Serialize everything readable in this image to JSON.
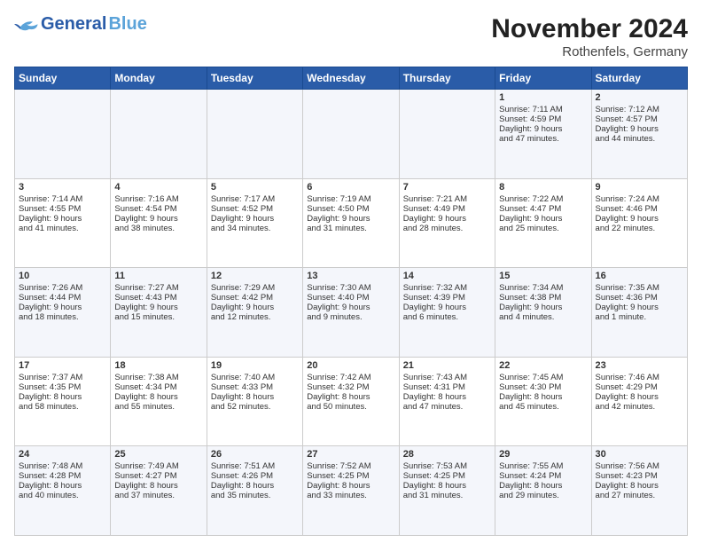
{
  "header": {
    "logo_general": "General",
    "logo_blue": "Blue",
    "title": "November 2024",
    "subtitle": "Rothenfels, Germany"
  },
  "weekdays": [
    "Sunday",
    "Monday",
    "Tuesday",
    "Wednesday",
    "Thursday",
    "Friday",
    "Saturday"
  ],
  "weeks": [
    [
      {
        "day": "",
        "lines": []
      },
      {
        "day": "",
        "lines": []
      },
      {
        "day": "",
        "lines": []
      },
      {
        "day": "",
        "lines": []
      },
      {
        "day": "",
        "lines": []
      },
      {
        "day": "1",
        "lines": [
          "Sunrise: 7:11 AM",
          "Sunset: 4:59 PM",
          "Daylight: 9 hours",
          "and 47 minutes."
        ]
      },
      {
        "day": "2",
        "lines": [
          "Sunrise: 7:12 AM",
          "Sunset: 4:57 PM",
          "Daylight: 9 hours",
          "and 44 minutes."
        ]
      }
    ],
    [
      {
        "day": "3",
        "lines": [
          "Sunrise: 7:14 AM",
          "Sunset: 4:55 PM",
          "Daylight: 9 hours",
          "and 41 minutes."
        ]
      },
      {
        "day": "4",
        "lines": [
          "Sunrise: 7:16 AM",
          "Sunset: 4:54 PM",
          "Daylight: 9 hours",
          "and 38 minutes."
        ]
      },
      {
        "day": "5",
        "lines": [
          "Sunrise: 7:17 AM",
          "Sunset: 4:52 PM",
          "Daylight: 9 hours",
          "and 34 minutes."
        ]
      },
      {
        "day": "6",
        "lines": [
          "Sunrise: 7:19 AM",
          "Sunset: 4:50 PM",
          "Daylight: 9 hours",
          "and 31 minutes."
        ]
      },
      {
        "day": "7",
        "lines": [
          "Sunrise: 7:21 AM",
          "Sunset: 4:49 PM",
          "Daylight: 9 hours",
          "and 28 minutes."
        ]
      },
      {
        "day": "8",
        "lines": [
          "Sunrise: 7:22 AM",
          "Sunset: 4:47 PM",
          "Daylight: 9 hours",
          "and 25 minutes."
        ]
      },
      {
        "day": "9",
        "lines": [
          "Sunrise: 7:24 AM",
          "Sunset: 4:46 PM",
          "Daylight: 9 hours",
          "and 22 minutes."
        ]
      }
    ],
    [
      {
        "day": "10",
        "lines": [
          "Sunrise: 7:26 AM",
          "Sunset: 4:44 PM",
          "Daylight: 9 hours",
          "and 18 minutes."
        ]
      },
      {
        "day": "11",
        "lines": [
          "Sunrise: 7:27 AM",
          "Sunset: 4:43 PM",
          "Daylight: 9 hours",
          "and 15 minutes."
        ]
      },
      {
        "day": "12",
        "lines": [
          "Sunrise: 7:29 AM",
          "Sunset: 4:42 PM",
          "Daylight: 9 hours",
          "and 12 minutes."
        ]
      },
      {
        "day": "13",
        "lines": [
          "Sunrise: 7:30 AM",
          "Sunset: 4:40 PM",
          "Daylight: 9 hours",
          "and 9 minutes."
        ]
      },
      {
        "day": "14",
        "lines": [
          "Sunrise: 7:32 AM",
          "Sunset: 4:39 PM",
          "Daylight: 9 hours",
          "and 6 minutes."
        ]
      },
      {
        "day": "15",
        "lines": [
          "Sunrise: 7:34 AM",
          "Sunset: 4:38 PM",
          "Daylight: 9 hours",
          "and 4 minutes."
        ]
      },
      {
        "day": "16",
        "lines": [
          "Sunrise: 7:35 AM",
          "Sunset: 4:36 PM",
          "Daylight: 9 hours",
          "and 1 minute."
        ]
      }
    ],
    [
      {
        "day": "17",
        "lines": [
          "Sunrise: 7:37 AM",
          "Sunset: 4:35 PM",
          "Daylight: 8 hours",
          "and 58 minutes."
        ]
      },
      {
        "day": "18",
        "lines": [
          "Sunrise: 7:38 AM",
          "Sunset: 4:34 PM",
          "Daylight: 8 hours",
          "and 55 minutes."
        ]
      },
      {
        "day": "19",
        "lines": [
          "Sunrise: 7:40 AM",
          "Sunset: 4:33 PM",
          "Daylight: 8 hours",
          "and 52 minutes."
        ]
      },
      {
        "day": "20",
        "lines": [
          "Sunrise: 7:42 AM",
          "Sunset: 4:32 PM",
          "Daylight: 8 hours",
          "and 50 minutes."
        ]
      },
      {
        "day": "21",
        "lines": [
          "Sunrise: 7:43 AM",
          "Sunset: 4:31 PM",
          "Daylight: 8 hours",
          "and 47 minutes."
        ]
      },
      {
        "day": "22",
        "lines": [
          "Sunrise: 7:45 AM",
          "Sunset: 4:30 PM",
          "Daylight: 8 hours",
          "and 45 minutes."
        ]
      },
      {
        "day": "23",
        "lines": [
          "Sunrise: 7:46 AM",
          "Sunset: 4:29 PM",
          "Daylight: 8 hours",
          "and 42 minutes."
        ]
      }
    ],
    [
      {
        "day": "24",
        "lines": [
          "Sunrise: 7:48 AM",
          "Sunset: 4:28 PM",
          "Daylight: 8 hours",
          "and 40 minutes."
        ]
      },
      {
        "day": "25",
        "lines": [
          "Sunrise: 7:49 AM",
          "Sunset: 4:27 PM",
          "Daylight: 8 hours",
          "and 37 minutes."
        ]
      },
      {
        "day": "26",
        "lines": [
          "Sunrise: 7:51 AM",
          "Sunset: 4:26 PM",
          "Daylight: 8 hours",
          "and 35 minutes."
        ]
      },
      {
        "day": "27",
        "lines": [
          "Sunrise: 7:52 AM",
          "Sunset: 4:25 PM",
          "Daylight: 8 hours",
          "and 33 minutes."
        ]
      },
      {
        "day": "28",
        "lines": [
          "Sunrise: 7:53 AM",
          "Sunset: 4:25 PM",
          "Daylight: 8 hours",
          "and 31 minutes."
        ]
      },
      {
        "day": "29",
        "lines": [
          "Sunrise: 7:55 AM",
          "Sunset: 4:24 PM",
          "Daylight: 8 hours",
          "and 29 minutes."
        ]
      },
      {
        "day": "30",
        "lines": [
          "Sunrise: 7:56 AM",
          "Sunset: 4:23 PM",
          "Daylight: 8 hours",
          "and 27 minutes."
        ]
      }
    ]
  ]
}
